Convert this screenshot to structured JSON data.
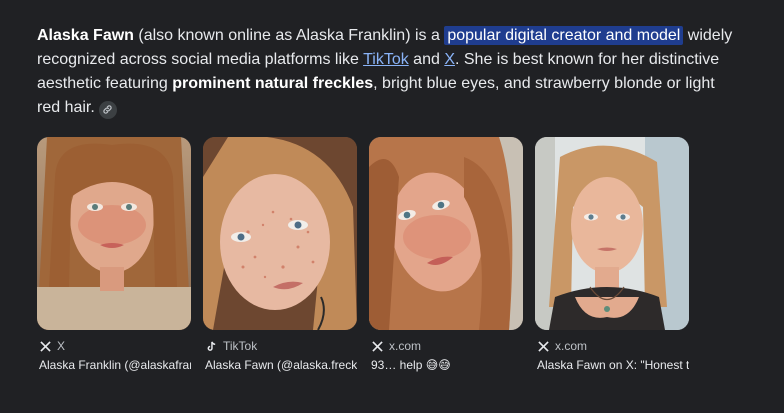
{
  "answer": {
    "subject": "Alaska Fawn",
    "t1": " (also known online as Alaska Franklin) is a ",
    "highlight": "popular digital creator and model",
    "t2": " widely recognized across social media platforms like ",
    "link1": "TikTok",
    "t3": " and ",
    "link2": "X",
    "t4": ". She is best known for her distinctive aesthetic featuring ",
    "bold2": "prominent natural freckles",
    "t5": ", bright blue eyes, and strawberry blonde or light red hair.",
    "citation_icon": "link-icon"
  },
  "images": [
    {
      "source": "X",
      "source_icon": "x-logo-icon",
      "caption": "Alaska Franklin (@alaskafranklin)"
    },
    {
      "source": "TikTok",
      "source_icon": "tiktok-logo-icon",
      "caption": "Alaska Fawn (@alaska.freckles)"
    },
    {
      "source": "x.com",
      "source_icon": "x-logo-icon",
      "caption": "93… help 😅😅"
    },
    {
      "source": "x.com",
      "source_icon": "x-logo-icon",
      "caption": "Alaska Fawn on X: \"Honest thoughts"
    }
  ],
  "colors": {
    "background": "#202124",
    "text": "#e8eaed",
    "link": "#8ab4f8",
    "highlight": "#1f3d8f"
  }
}
